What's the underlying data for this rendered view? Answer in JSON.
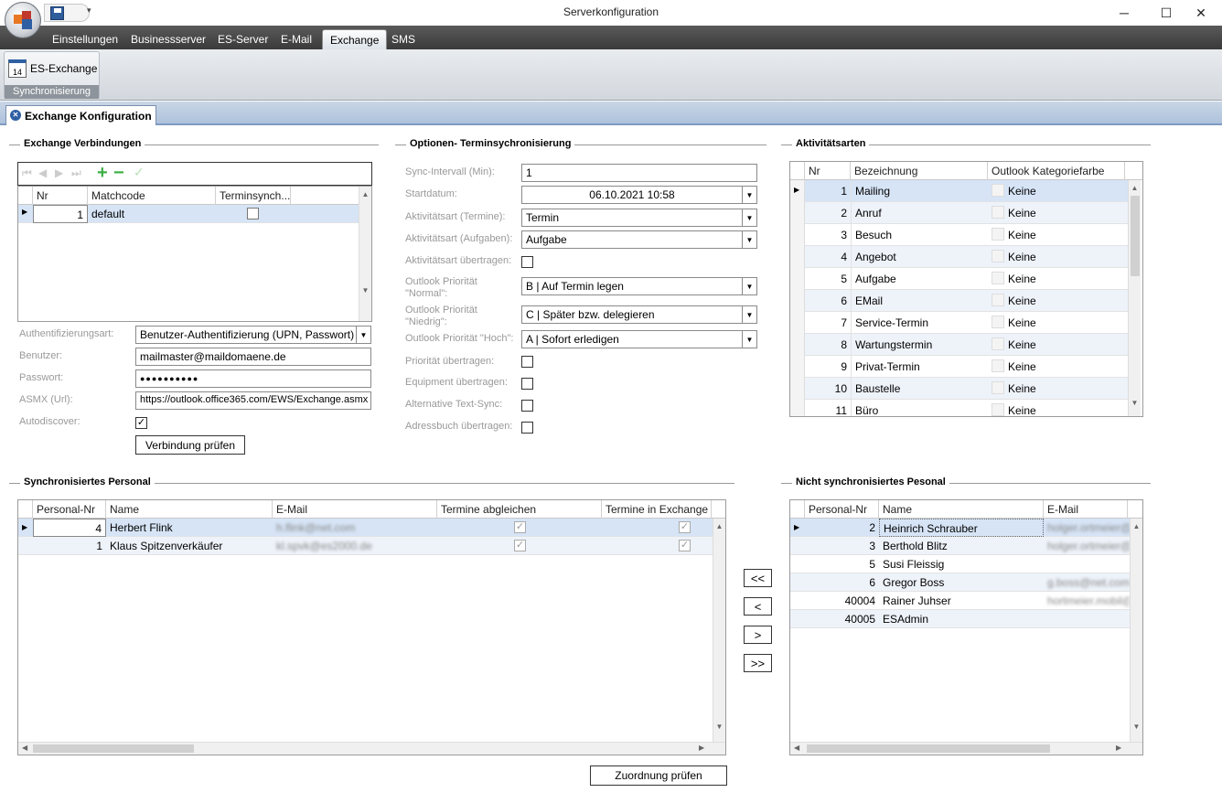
{
  "window": {
    "title": "Serverkonfiguration"
  },
  "menu": {
    "tabs": [
      "Einstellungen",
      "Businessserver",
      "ES-Server",
      "E-Mail",
      "Exchange",
      "SMS"
    ],
    "active": "Exchange"
  },
  "ribbon": {
    "button": "ES-Exchange",
    "group": "Synchronisierung"
  },
  "doc_tab": "Exchange Konfiguration",
  "exchange": {
    "title": "Exchange Verbindungen",
    "columns": [
      "Nr",
      "Matchcode",
      "Terminsynch..."
    ],
    "rows": [
      {
        "nr": "1",
        "matchcode": "default",
        "terminsync": false
      }
    ],
    "auth_label": "Authentifizierungsart:",
    "auth_value": "Benutzer-Authentifizierung (UPN, Passwort)",
    "user_label": "Benutzer:",
    "user_value": "mailmaster@maildomaene.de",
    "pw_label": "Passwort:",
    "pw_value": "●●●●●●●●●●",
    "asmx_label": "ASMX (Url):",
    "asmx_value": "https://outlook.office365.com/EWS/Exchange.asmx",
    "autodiscover_label": "Autodiscover:",
    "autodiscover": true,
    "check_button": "Verbindung prüfen"
  },
  "options": {
    "title": "Optionen- Terminsychronisierung",
    "sync_label": "Sync-Intervall (Min):",
    "sync_value": "1",
    "start_label": "Startdatum:",
    "start_value": "06.10.2021 10:58",
    "akt_termine_label": "Aktivitätsart (Termine):",
    "akt_termine_value": "Termin",
    "akt_aufgaben_label": "Aktivitätsart (Aufgaben):",
    "akt_aufgaben_value": "Aufgabe",
    "akt_uebertragen_label": "Aktivitätsart übertragen:",
    "prio_normal_label1": "Outlook Priorität",
    "prio_normal_label2": "\"Normal\":",
    "prio_normal_value": "B | Auf Termin legen",
    "prio_niedrig_label1": "Outlook Priorität",
    "prio_niedrig_label2": "\"Niedrig\":",
    "prio_niedrig_value": "C | Später bzw. delegieren",
    "prio_hoch_label": "Outlook Priorität \"Hoch\":",
    "prio_hoch_value": "A | Sofort erledigen",
    "prio_uebertragen_label": "Priorität übertragen:",
    "equipment_label": "Equipment übertragen:",
    "alt_text_label": "Alternative Text-Sync:",
    "adressbuch_label": "Adressbuch übertragen:"
  },
  "aktivitaeten": {
    "title": "Aktivitätsarten",
    "columns": [
      "Nr",
      "Bezeichnung",
      "Outlook Kategoriefarbe"
    ],
    "rows": [
      {
        "nr": "1",
        "name": "Mailing",
        "farbe": "Keine"
      },
      {
        "nr": "2",
        "name": "Anruf",
        "farbe": "Keine"
      },
      {
        "nr": "3",
        "name": "Besuch",
        "farbe": "Keine"
      },
      {
        "nr": "4",
        "name": "Angebot",
        "farbe": "Keine"
      },
      {
        "nr": "5",
        "name": "Aufgabe",
        "farbe": "Keine"
      },
      {
        "nr": "6",
        "name": "EMail",
        "farbe": "Keine"
      },
      {
        "nr": "7",
        "name": "Service-Termin",
        "farbe": "Keine"
      },
      {
        "nr": "8",
        "name": "Wartungstermin",
        "farbe": "Keine"
      },
      {
        "nr": "9",
        "name": "Privat-Termin",
        "farbe": "Keine"
      },
      {
        "nr": "10",
        "name": "Baustelle",
        "farbe": "Keine"
      },
      {
        "nr": "11",
        "name": "Büro",
        "farbe": "Keine"
      }
    ]
  },
  "sync": {
    "title": "Synchronisiertes Personal",
    "columns": [
      "Personal-Nr",
      "Name",
      "E-Mail",
      "Termine abgleichen",
      "Termine in Exchange lö"
    ],
    "rows": [
      {
        "nr": "4",
        "name": "Herbert Flink",
        "email": "h.flink@net.com",
        "abgleichen": true,
        "loeschen": true
      },
      {
        "nr": "1",
        "name": "Klaus Spitzenverkäufer",
        "email": "kl.spvk@es2000.de",
        "abgleichen": true,
        "loeschen": true
      }
    ],
    "check_button": "Zuordnung prüfen"
  },
  "transfer": {
    "all_left": "<<",
    "left": "<",
    "right": ">",
    "all_right": ">>"
  },
  "nonsync": {
    "title": "Nicht synchronisiertes Pesonal",
    "columns": [
      "Personal-Nr",
      "Name",
      "E-Mail"
    ],
    "rows": [
      {
        "nr": "2",
        "name": "Heinrich Schrauber",
        "email": "holger.ortmeier@e"
      },
      {
        "nr": "3",
        "name": "Berthold Blitz",
        "email": "holger.ortmeier@e"
      },
      {
        "nr": "5",
        "name": "Susi Fleissig",
        "email": ""
      },
      {
        "nr": "6",
        "name": "Gregor Boss",
        "email": "g.boss@net.com"
      },
      {
        "nr": "40004",
        "name": "Rainer Juhser",
        "email": "hortmeier.mobil@"
      },
      {
        "nr": "40005",
        "name": "ESAdmin",
        "email": ""
      }
    ]
  }
}
